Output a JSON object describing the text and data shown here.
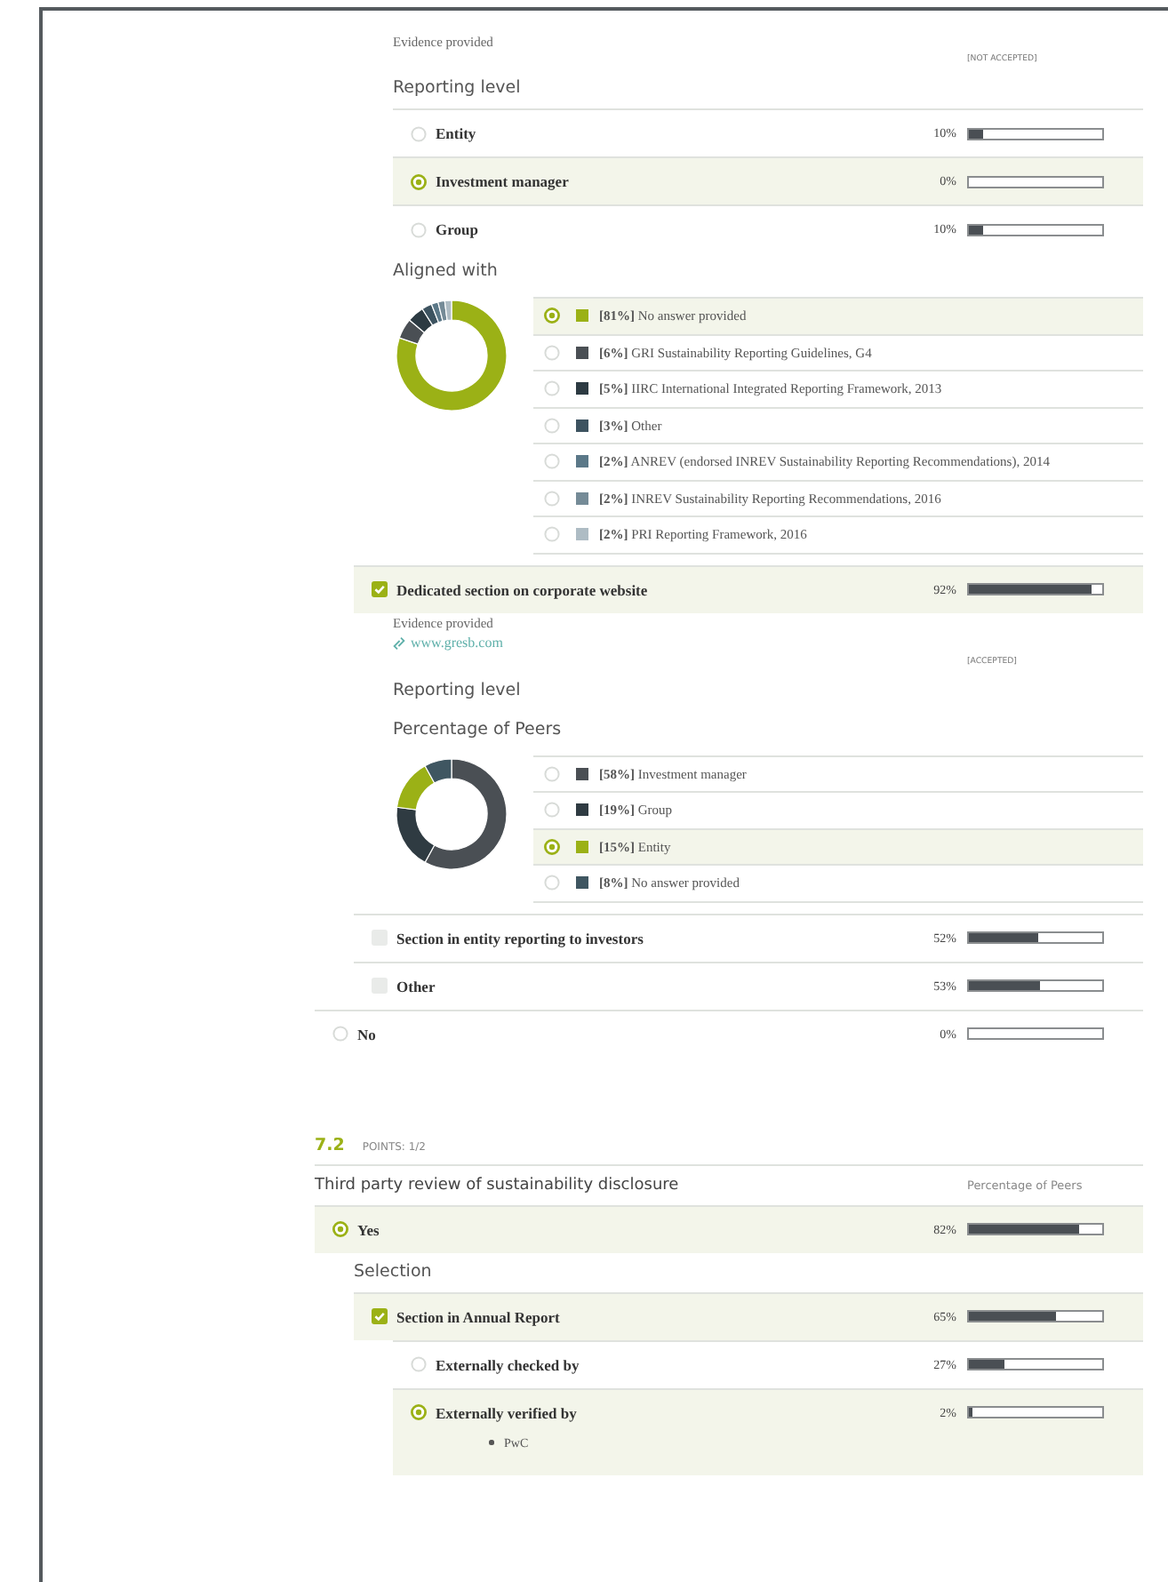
{
  "questions": [
    {
      "items": [
        {
          "kind": "group",
          "children": [
            {
              "kind": "group",
              "children": [
                {
                  "kind": "note",
                  "text": "Evidence provided"
                },
                {
                  "kind": "status",
                  "text": "[NOT ACCEPTED]"
                },
                {
                  "kind": "heading",
                  "text": "Reporting level"
                },
                {
                  "kind": "radio",
                  "label": "Entity",
                  "selected": false,
                  "percent": "10%",
                  "level": 0.1
                },
                {
                  "kind": "radio",
                  "label": "Investment manager",
                  "selected": true,
                  "percent": "0%",
                  "level": 0
                },
                {
                  "kind": "radio",
                  "label": "Group",
                  "selected": false,
                  "percent": "10%",
                  "level": 0.1
                },
                {
                  "kind": "heading",
                  "text": "Aligned with"
                },
                {
                  "kind": "donut",
                  "chart_data": {
                    "type": "donut",
                    "categories": [
                      "No answer provided",
                      "GRI Sustainability Reporting Guidelines, G4",
                      "IIRC International Integrated Reporting Framework, 2013",
                      "Other",
                      "ANREV (endorsed INREV Sustainability Reporting Recommendations), 2014",
                      "INREV Sustainability Reporting Recommendations, 2016",
                      "PRI Reporting Framework, 2016"
                    ],
                    "values": [
                      81,
                      6,
                      5,
                      3,
                      2,
                      2,
                      2
                    ]
                  },
                  "legend": [
                    {
                      "percent": "[81%]",
                      "selected": true,
                      "color": "#9bb116"
                    },
                    {
                      "percent": "[6%]",
                      "selected": false,
                      "color": "#4a4f54"
                    },
                    {
                      "percent": "[5%]",
                      "selected": false,
                      "color": "#2c3a42"
                    },
                    {
                      "percent": "[3%]",
                      "selected": false,
                      "color": "#3d5360"
                    },
                    {
                      "percent": "[2%]",
                      "selected": false,
                      "color": "#5b7888"
                    },
                    {
                      "percent": "[2%]",
                      "selected": false,
                      "color": "#758b97"
                    },
                    {
                      "percent": "[2%]",
                      "selected": false,
                      "color": "#aebcc4"
                    }
                  ]
                }
              ]
            },
            {
              "kind": "checkbox",
              "label": "Dedicated section on corporate website",
              "checked": true,
              "percent": "92%",
              "level": 0.92,
              "children": [
                {
                  "kind": "note",
                  "text": "Evidence provided"
                },
                {
                  "kind": "link",
                  "text": "www.gresb.com"
                },
                {
                  "kind": "status",
                  "text": "[ACCEPTED]"
                },
                {
                  "kind": "heading",
                  "text": "Reporting level"
                },
                {
                  "kind": "heading",
                  "text": "Percentage of Peers"
                },
                {
                  "kind": "donut",
                  "chart_data": {
                    "type": "donut",
                    "categories": [
                      "Investment manager",
                      "Group",
                      "Entity",
                      "No answer provided"
                    ],
                    "values": [
                      58,
                      19,
                      15,
                      8
                    ]
                  },
                  "legend": [
                    {
                      "percent": "[58%]",
                      "selected": false,
                      "color": "#4a4f54"
                    },
                    {
                      "percent": "[19%]",
                      "selected": false,
                      "color": "#2f3b42"
                    },
                    {
                      "percent": "[15%]",
                      "selected": true,
                      "color": "#9bb116"
                    },
                    {
                      "percent": "[8%]",
                      "selected": false,
                      "color": "#3f5661"
                    }
                  ]
                }
              ]
            },
            {
              "kind": "checkbox",
              "label": "Section in entity reporting to investors",
              "checked": false,
              "percent": "52%",
              "level": 0.52
            },
            {
              "kind": "checkbox",
              "label": "Other",
              "checked": false,
              "percent": "53%",
              "level": 0.53
            }
          ]
        },
        {
          "kind": "radio",
          "label": "No",
          "selected": false,
          "percent": "0%",
          "level": 0
        }
      ]
    },
    {
      "number": "7.2",
      "points": "POINTS: 1/2",
      "title": "Third party review of sustainability disclosure",
      "column_header": "Percentage of Peers",
      "items": [
        {
          "kind": "radio",
          "label": "Yes",
          "selected": true,
          "percent": "82%",
          "level": 0.82,
          "children": [
            {
              "kind": "heading",
              "text": "Selection"
            },
            {
              "kind": "checkbox",
              "label": "Section in Annual Report",
              "checked": true,
              "percent": "65%",
              "level": 0.65,
              "children": [
                {
                  "kind": "radio",
                  "label": "Externally checked by",
                  "selected": false,
                  "percent": "27%",
                  "level": 0.27
                },
                {
                  "kind": "radio",
                  "label": "Externally verified by",
                  "selected": true,
                  "percent": "2%",
                  "level": 0.02,
                  "answers": [
                    "PwC"
                  ]
                }
              ]
            }
          ]
        }
      ]
    }
  ]
}
